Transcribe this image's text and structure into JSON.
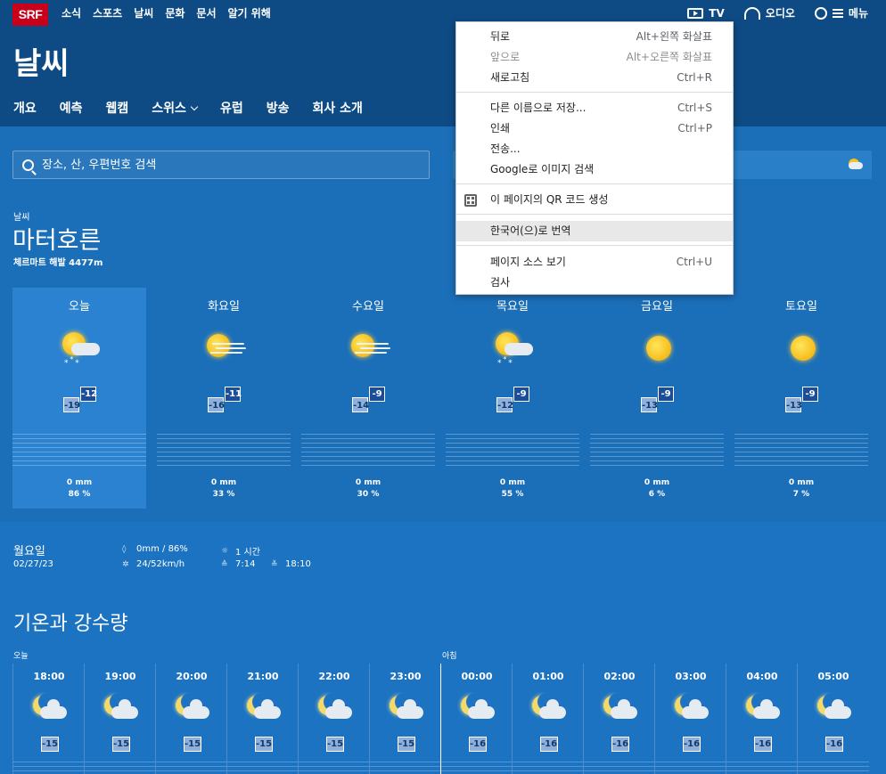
{
  "header": {
    "logo": "SRF",
    "topnav": [
      "소식",
      "스포츠",
      "날씨",
      "문화",
      "문서",
      "알기 위해"
    ],
    "tv_label": "TV",
    "audio_label": "오디오",
    "menu_label": "메뉴",
    "title": "날씨",
    "subnav": [
      "개요",
      "예측",
      "웹캠",
      "스위스",
      "유럽",
      "방송",
      "회사 소개"
    ]
  },
  "search": {
    "placeholder": "장소, 산, 우편번호 검색"
  },
  "location": {
    "kicker": "날씨",
    "name": "마터호른",
    "sub": "체르마트 해발 4477m"
  },
  "days": [
    {
      "name": "오늘",
      "icon": "sun-cloud-snow-icon",
      "min": "-19",
      "max": "-12",
      "precip": "0 mm",
      "prob": "86 %"
    },
    {
      "name": "화요일",
      "icon": "sun-fog-icon",
      "min": "-16",
      "max": "-11",
      "precip": "0 mm",
      "prob": "33 %"
    },
    {
      "name": "수요일",
      "icon": "sun-fog-icon",
      "min": "-14",
      "max": "-9",
      "precip": "0 mm",
      "prob": "30 %"
    },
    {
      "name": "목요일",
      "icon": "sun-cloud-snow-icon",
      "min": "-12",
      "max": "-9",
      "precip": "0 mm",
      "prob": "55 %"
    },
    {
      "name": "금요일",
      "icon": "sun-icon",
      "min": "-13",
      "max": "-9",
      "precip": "0 mm",
      "prob": "6 %"
    },
    {
      "name": "토요일",
      "icon": "sun-icon",
      "min": "-13",
      "max": "-9",
      "precip": "0 mm",
      "prob": "7 %"
    }
  ],
  "detail": {
    "day": "월요일",
    "date": "02/27/23",
    "precip": "0mm / 86%",
    "wind": "24/52km/h",
    "sunshine": "1 시간",
    "sunrise": "7:14",
    "sunset": "18:10"
  },
  "section": {
    "title": "기온과 강수량",
    "period_evening": "오늘",
    "period_morning": "아침"
  },
  "hours": [
    {
      "time": "18:00",
      "temp": "-15"
    },
    {
      "time": "19:00",
      "temp": "-15"
    },
    {
      "time": "20:00",
      "temp": "-15"
    },
    {
      "time": "21:00",
      "temp": "-15"
    },
    {
      "time": "22:00",
      "temp": "-15"
    },
    {
      "time": "23:00",
      "temp": "-15"
    },
    {
      "time": "00:00",
      "temp": "-16"
    },
    {
      "time": "01:00",
      "temp": "-16"
    },
    {
      "time": "02:00",
      "temp": "-16"
    },
    {
      "time": "03:00",
      "temp": "-16"
    },
    {
      "time": "04:00",
      "temp": "-16"
    },
    {
      "time": "05:00",
      "temp": "-16"
    }
  ],
  "context_menu": {
    "back": {
      "label": "뒤로",
      "shortcut": "Alt+왼쪽 화살표"
    },
    "forward": {
      "label": "앞으로",
      "shortcut": "Alt+오른쪽 화살표"
    },
    "reload": {
      "label": "새로고침",
      "shortcut": "Ctrl+R"
    },
    "save_as": {
      "label": "다른 이름으로 저장...",
      "shortcut": "Ctrl+S"
    },
    "print": {
      "label": "인쇄",
      "shortcut": "Ctrl+P"
    },
    "cast": {
      "label": "전송..."
    },
    "google_image": {
      "label": "Google로 이미지 검색"
    },
    "qr": {
      "label": "이 페이지의 QR 코드 생성"
    },
    "translate": {
      "label": "한국어(으)로 번역"
    },
    "view_source": {
      "label": "페이지 소스 보기",
      "shortcut": "Ctrl+U"
    },
    "inspect": {
      "label": "검사"
    }
  }
}
